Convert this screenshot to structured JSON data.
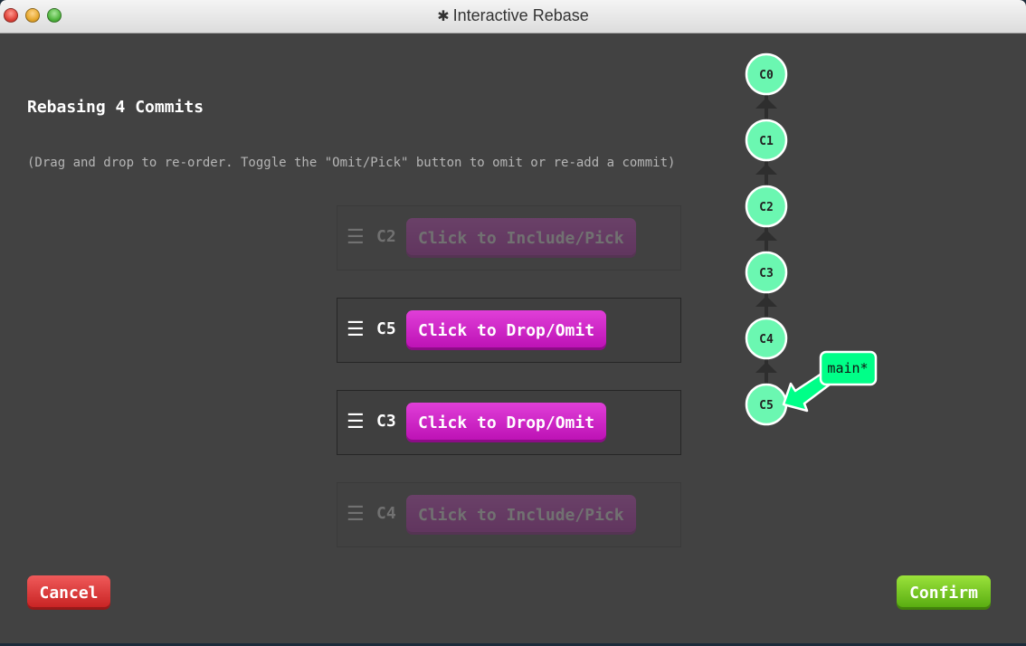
{
  "window": {
    "title": "Interactive Rebase",
    "gear_icon": "gear-icon"
  },
  "dialog": {
    "heading": "Rebasing 4 Commits",
    "help_text": "(Drag and drop to re-order. Toggle the \"Omit/Pick\" button to omit or re-add a commit)"
  },
  "commits": [
    {
      "id": "C2",
      "state": "omitted",
      "button_label": "Click to Include/Pick"
    },
    {
      "id": "C5",
      "state": "picked",
      "button_label": "Click to Drop/Omit"
    },
    {
      "id": "C3",
      "state": "picked",
      "button_label": "Click to Drop/Omit"
    },
    {
      "id": "C4",
      "state": "omitted",
      "button_label": "Click to Include/Pick"
    }
  ],
  "graph": {
    "nodes": [
      "C0",
      "C1",
      "C2",
      "C3",
      "C4",
      "C5"
    ],
    "branch_label": "main*",
    "branch_target": "C5"
  },
  "buttons": {
    "cancel": "Cancel",
    "confirm": "Confirm"
  },
  "colors": {
    "background": "#424242",
    "pick_button": "#cc22c4",
    "cancel_button": "#d63434",
    "confirm_button": "#78c424",
    "node_fill": "#6bf7b1",
    "branch_fill": "#00ff88"
  }
}
